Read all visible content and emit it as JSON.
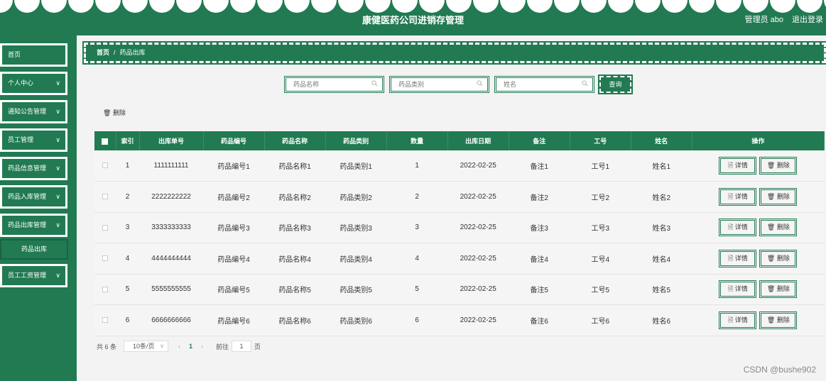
{
  "header": {
    "title": "康健医药公司进销存管理",
    "user": "管理员 abo",
    "logout": "退出登录"
  },
  "sidebar": {
    "items": [
      {
        "label": "首页",
        "has_chevron": false
      },
      {
        "label": "个人中心",
        "has_chevron": true
      },
      {
        "label": "通知公告管理",
        "has_chevron": true
      },
      {
        "label": "员工管理",
        "has_chevron": true
      },
      {
        "label": "药品信息管理",
        "has_chevron": true
      },
      {
        "label": "药品入库管理",
        "has_chevron": true
      },
      {
        "label": "药品出库管理",
        "has_chevron": true
      },
      {
        "label": "员工工资管理",
        "has_chevron": true
      }
    ],
    "submenu": {
      "label": "药品出库"
    },
    "chevron": "∨"
  },
  "breadcrumb": {
    "home": "首页",
    "separator": "/",
    "current": "药品出库"
  },
  "search": {
    "name_placeholder": "药品名称",
    "category_placeholder": "药品类别",
    "person_placeholder": "姓名",
    "query_label": "查询"
  },
  "toolbar": {
    "delete_icon": "🗑",
    "delete_label": "删除"
  },
  "table": {
    "headers": [
      "",
      "索引",
      "出库单号",
      "药品编号",
      "药品名称",
      "药品类别",
      "数量",
      "出库日期",
      "备注",
      "工号",
      "姓名",
      "操作"
    ],
    "rows": [
      [
        "1",
        "1111111111",
        "药品编号1",
        "药品名称1",
        "药品类别1",
        "1",
        "2022-02-25",
        "备注1",
        "工号1",
        "姓名1"
      ],
      [
        "2",
        "2222222222",
        "药品编号2",
        "药品名称2",
        "药品类别2",
        "2",
        "2022-02-25",
        "备注2",
        "工号2",
        "姓名2"
      ],
      [
        "3",
        "3333333333",
        "药品编号3",
        "药品名称3",
        "药品类别3",
        "3",
        "2022-02-25",
        "备注3",
        "工号3",
        "姓名3"
      ],
      [
        "4",
        "4444444444",
        "药品编号4",
        "药品名称4",
        "药品类别4",
        "4",
        "2022-02-25",
        "备注4",
        "工号4",
        "姓名4"
      ],
      [
        "5",
        "5555555555",
        "药品编号5",
        "药品名称5",
        "药品类别5",
        "5",
        "2022-02-25",
        "备注5",
        "工号5",
        "姓名5"
      ],
      [
        "6",
        "6666666666",
        "药品编号6",
        "药品名称6",
        "药品类别6",
        "6",
        "2022-02-25",
        "备注6",
        "工号6",
        "姓名6"
      ]
    ],
    "detail_label": "详情",
    "delete_label": "删除",
    "detail_icon": "🗎",
    "delete_icon": "🗑"
  },
  "pagination": {
    "total": "共 6 条",
    "page_size": "10条/页",
    "current_page": "1",
    "goto_label": "前往",
    "goto_value": "1",
    "page_suffix": "页",
    "prev": "‹",
    "next": "›",
    "dropdown": "∨"
  },
  "watermark": "CSDN @bushe902",
  "colors": {
    "primary": "#217a52",
    "background": "#f3f3f3"
  }
}
